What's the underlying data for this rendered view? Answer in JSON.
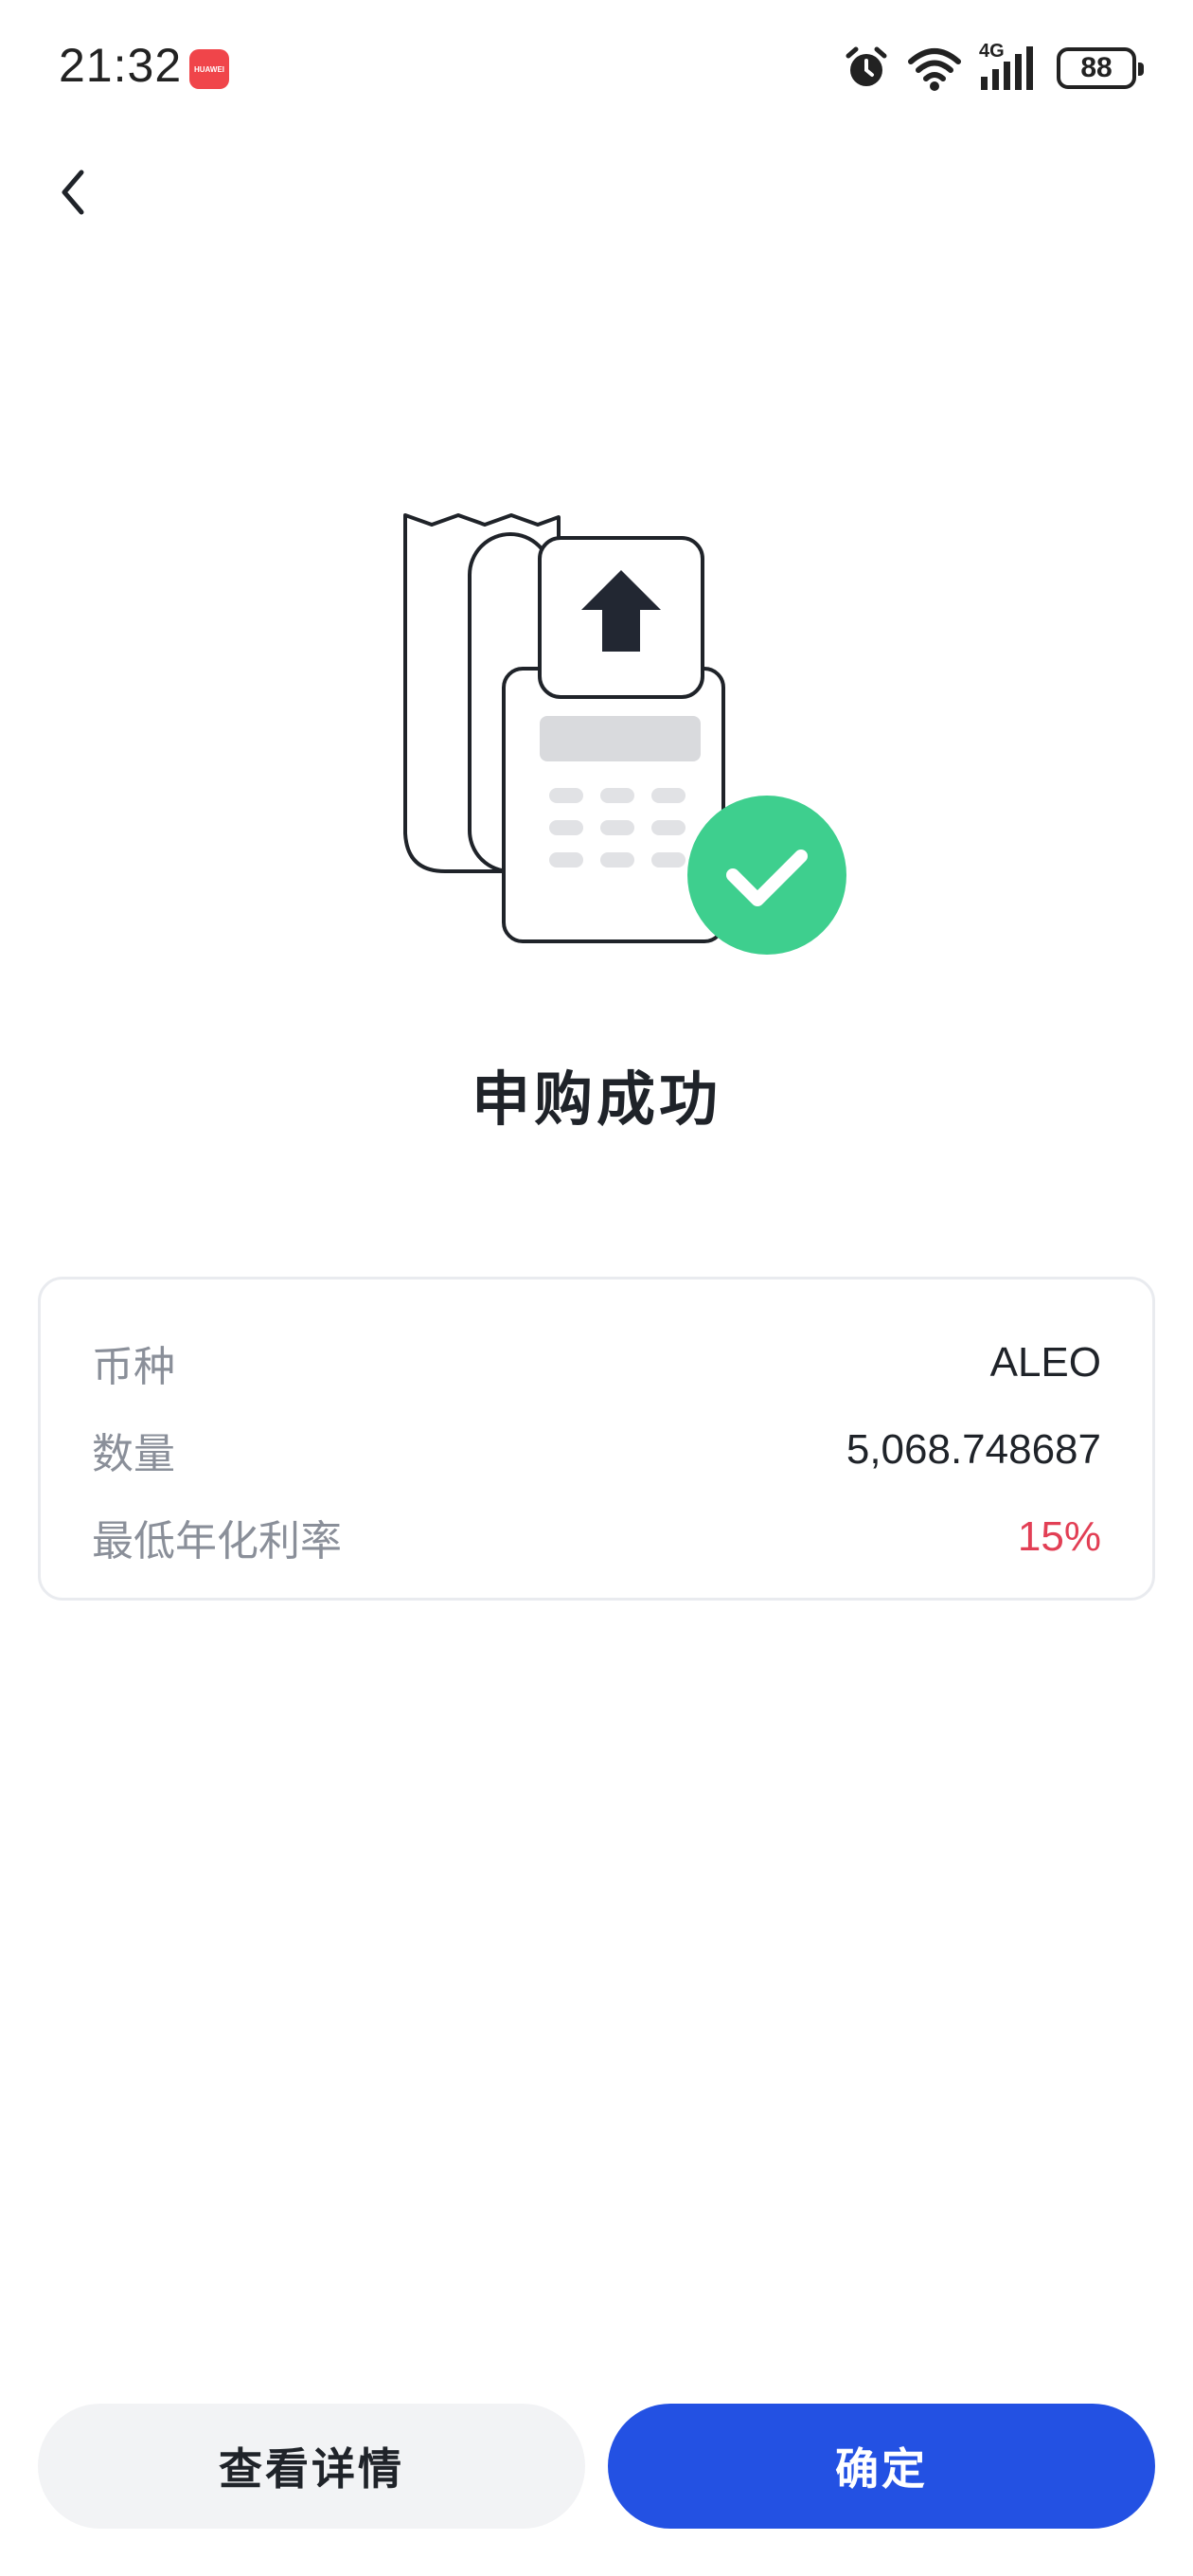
{
  "status_bar": {
    "time": "21:32",
    "app_badge": "HUAWEI",
    "battery": "88",
    "network": "4G",
    "icons": [
      "alarm-icon",
      "wifi-icon",
      "signal-icon",
      "battery-icon"
    ]
  },
  "nav": {
    "back_icon": "chevron-left-icon"
  },
  "result": {
    "title": "申购成功",
    "icon": "receipt-success-illustration"
  },
  "details": [
    {
      "label": "币种",
      "value": "ALEO"
    },
    {
      "label": "数量",
      "value": "5,068.748687"
    },
    {
      "label": "最低年化利率",
      "value": "15%"
    }
  ],
  "buttons": {
    "details": "查看详情",
    "confirm": "确定"
  },
  "colors": {
    "primary": "#2351e3",
    "success": "#3ecf8e",
    "highlight": "#e23f55"
  }
}
